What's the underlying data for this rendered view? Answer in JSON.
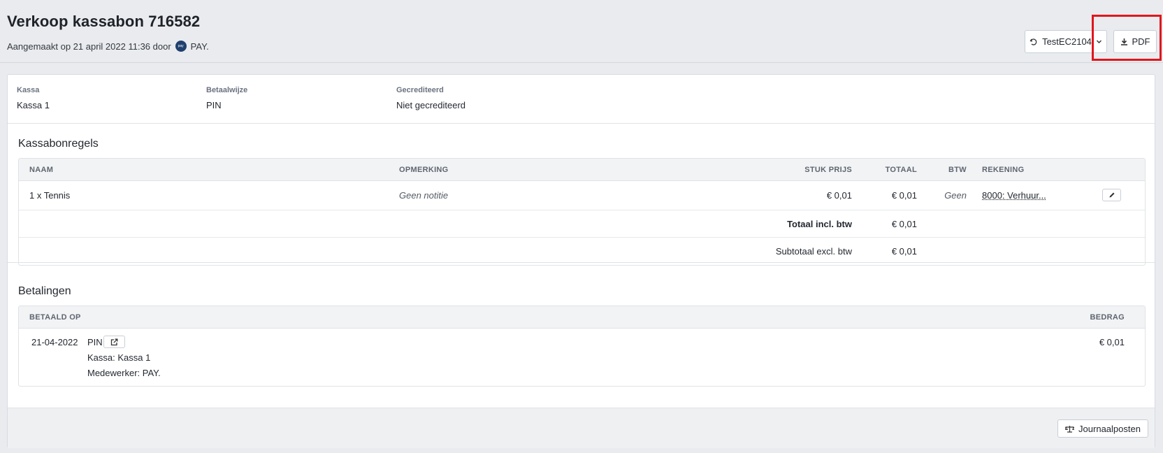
{
  "header": {
    "title": "Verkoop kassabon 716582",
    "subtitle_prefix": "Aangemaakt op 21 april 2022 11:36 door",
    "avatar_text": "pay",
    "user": "PAY.",
    "admin_selector_label": "TestEC2104",
    "pdf_label": "PDF"
  },
  "meta": {
    "kassa_label": "Kassa",
    "kassa_value": "Kassa 1",
    "betaalwijze_label": "Betaalwijze",
    "betaalwijze_value": "PIN",
    "gecrediteerd_label": "Gecrediteerd",
    "gecrediteerd_value": "Niet gecrediteerd"
  },
  "lines": {
    "title": "Kassabonregels",
    "columns": {
      "naam": "NAAM",
      "opmerking": "OPMERKING",
      "stukprijs": "STUK PRIJS",
      "totaal": "TOTAAL",
      "btw": "BTW",
      "rekening": "REKENING"
    },
    "rows": [
      {
        "naam": "1 x Tennis",
        "opmerking": "Geen notitie",
        "stukprijs": "€ 0,01",
        "totaal": "€ 0,01",
        "btw": "Geen",
        "rekening": "8000: Verhuur..."
      }
    ],
    "total_incl_label": "Totaal incl. btw",
    "total_incl_value": "€ 0,01",
    "subtotal_excl_label": "Subtotaal excl. btw",
    "subtotal_excl_value": "€ 0,01"
  },
  "payments": {
    "title": "Betalingen",
    "columns": {
      "betaald_op": "BETAALD OP",
      "bedrag": "BEDRAG"
    },
    "rows": [
      {
        "date": "21-04-2022",
        "method": "PIN",
        "kassa": "Kassa: Kassa 1",
        "medewerker": "Medewerker: PAY.",
        "amount": "€ 0,01"
      }
    ]
  },
  "footer": {
    "journal_label": "Journaalposten"
  },
  "colors": {
    "highlight": "#e0161c",
    "background": "#e9ebee"
  }
}
